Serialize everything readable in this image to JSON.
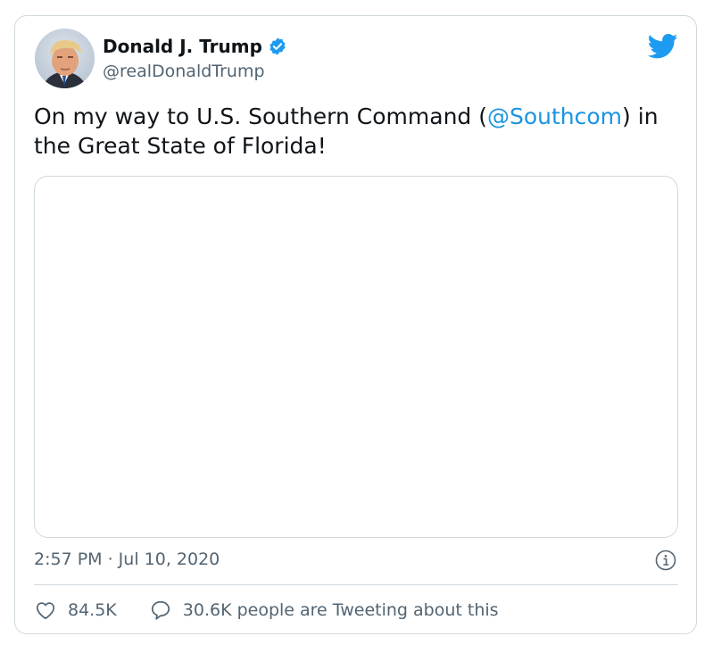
{
  "user": {
    "display_name": "Donald J. Trump",
    "handle": "@realDonaldTrump",
    "verified": true
  },
  "tweet": {
    "text_before": "On my way to U.S. Southern Command (",
    "mention": "@Southcom",
    "text_after": ") in the Great State of Florida!",
    "timestamp": "2:57 PM · Jul 10, 2020"
  },
  "stats": {
    "likes": "84.5K",
    "conversation": "30.6K people are Tweeting about this"
  },
  "colors": {
    "accent": "#1b95e0",
    "text": "#0f1419",
    "secondary": "#536471",
    "border": "#cfd9de"
  }
}
